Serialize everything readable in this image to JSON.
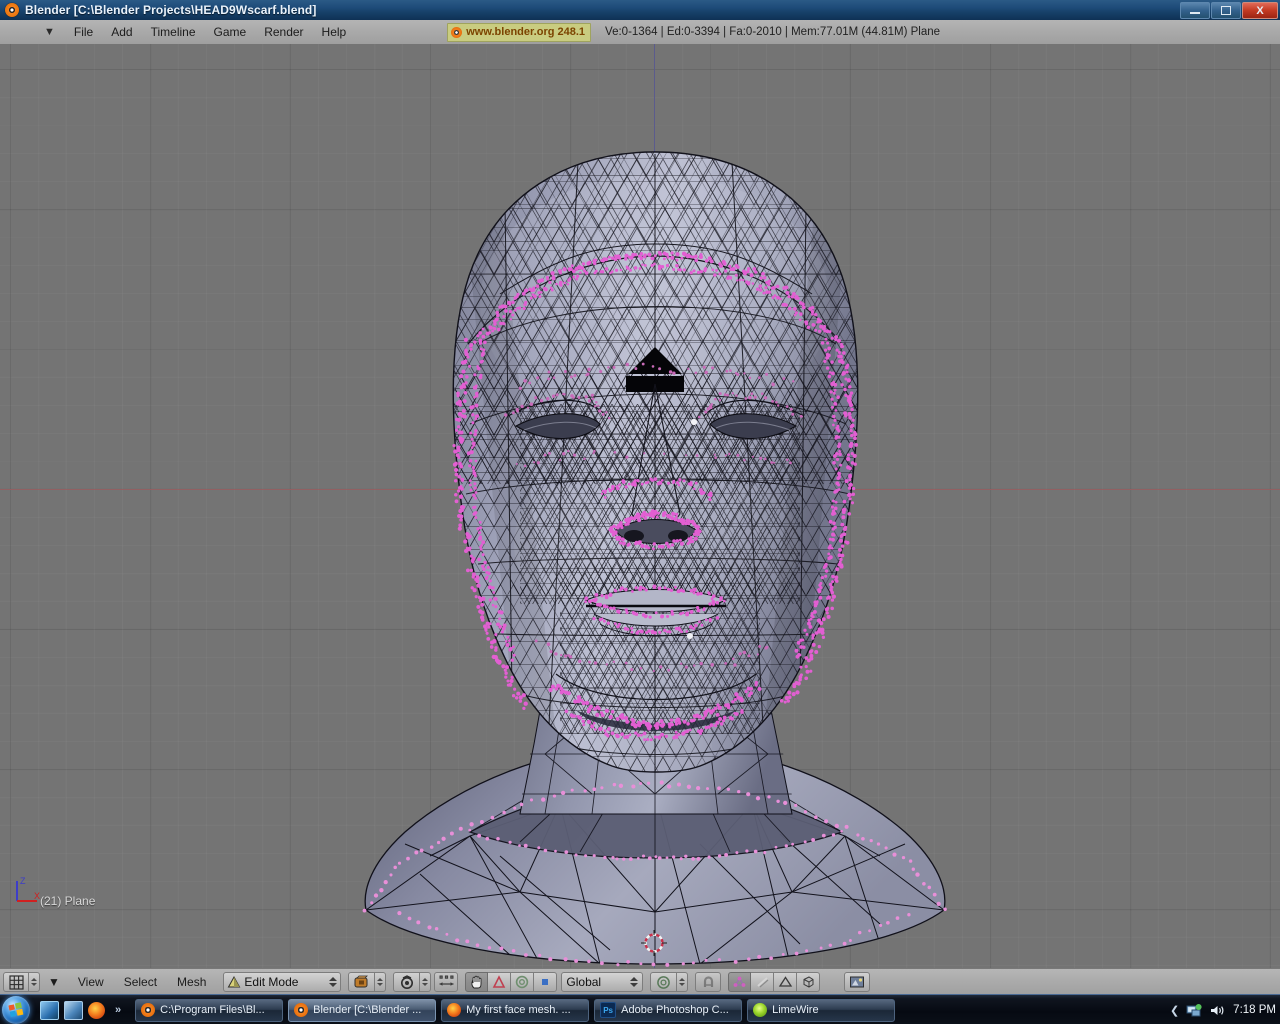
{
  "window": {
    "title": "Blender [C:\\Blender Projects\\HEAD9Wscarf.blend]",
    "icon": "blender-logo-icon",
    "minimize_label": "Minimize",
    "restore_label": "Restore",
    "close_label": "X"
  },
  "header": {
    "dropdown_icon": "chevron-down-icon",
    "menus": [
      {
        "label": "File"
      },
      {
        "label": "Add"
      },
      {
        "label": "Timeline"
      },
      {
        "label": "Game"
      },
      {
        "label": "Render"
      },
      {
        "label": "Help"
      }
    ],
    "version_badge": {
      "icon": "blender-logo-icon",
      "text": "www.blender.org 248.1",
      "bg": "#c9cc80",
      "fg": "#7c4400"
    },
    "stats": "Ve:0-1364 | Ed:0-3394 | Fa:0-2010 | Mem:77.01M (44.81M) Plane"
  },
  "viewport": {
    "background": "#747474",
    "x_axis_color": "#9a5f62",
    "z_axis_color": "#5a5a8e",
    "object_label": "(21) Plane",
    "axis_gizmo": {
      "z_label": "Z",
      "x_label": "X",
      "z_color": "#3d3dc8",
      "x_color": "#d02020"
    },
    "cursor_name": "3d-cursor",
    "mesh": {
      "name": "human-head-bust-wireframe",
      "surface_color": "#a8abc0",
      "wire_color": "#17171f",
      "selected_vertex_color": "#e05fd0"
    }
  },
  "view_header": {
    "editor_type_icon": "grid-editor-icon",
    "dropdown_icon": "chevron-down-icon",
    "menus": [
      {
        "label": "View"
      },
      {
        "label": "Select"
      },
      {
        "label": "Mesh"
      }
    ],
    "mode": {
      "icon": "edit-mode-icon",
      "label": "Edit Mode"
    },
    "draw_type_icon": "solid-shading-icon",
    "rotation_icon": "view-rotate-icon",
    "manipulator_move_icon": "manipulator-translate-icon",
    "manipulator_buttons": [
      {
        "icon": "hand-cursor-icon",
        "active": true
      },
      {
        "icon": "rotate-triangle-icon",
        "active": false
      },
      {
        "icon": "scale-circle-icon",
        "active": false
      },
      {
        "icon": "blue-square-icon",
        "active": false
      }
    ],
    "transform_orientation": {
      "label": "Global"
    },
    "pivot_icon": "pivot-center-icon",
    "snap_icon": "snap-magnet-icon",
    "select_modes": [
      {
        "icon": "vertex-select-icon",
        "active": true
      },
      {
        "icon": "edge-select-icon",
        "active": false
      },
      {
        "icon": "face-select-icon",
        "active": false
      },
      {
        "icon": "occlude-geometry-icon",
        "active": false
      }
    ],
    "render_icon": "render-preview-icon"
  },
  "taskbar": {
    "start_label": "Start",
    "quick_launch": [
      {
        "icon": "show-desktop-icon"
      },
      {
        "icon": "switch-windows-icon"
      },
      {
        "icon": "firefox-icon"
      }
    ],
    "overflow_label": "»",
    "items": [
      {
        "icon": "blender-logo-icon",
        "label": "C:\\Program Files\\Bl...",
        "active": false
      },
      {
        "icon": "blender-logo-icon",
        "label": "Blender [C:\\Blender ...",
        "active": true
      },
      {
        "icon": "firefox-icon",
        "label": "My first face mesh. ...",
        "active": false
      },
      {
        "icon": "photoshop-icon",
        "label": "Adobe Photoshop C...",
        "active": false
      },
      {
        "icon": "limewire-icon",
        "label": "LimeWire",
        "active": false
      }
    ],
    "tray": {
      "expand_icon": "chevron-left-icon",
      "icons": [
        {
          "icon": "network-icon"
        },
        {
          "icon": "volume-icon"
        }
      ],
      "clock": "7:18 PM"
    }
  }
}
